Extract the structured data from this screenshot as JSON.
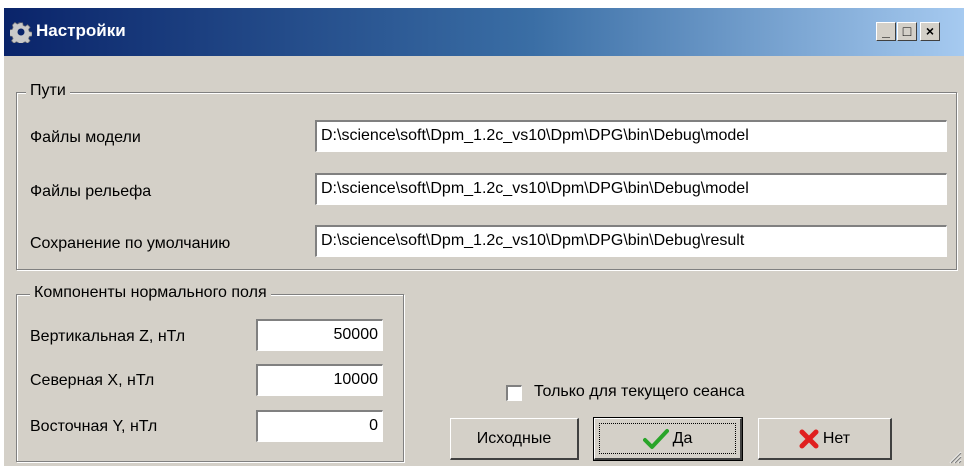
{
  "window": {
    "title": "Настройки",
    "controls": {
      "minimize": "_",
      "maximize": "□",
      "close": "×"
    }
  },
  "paths": {
    "group_label": "Пути",
    "model_files_label": "Файлы модели",
    "model_files_value": "D:\\science\\soft\\Dpm_1.2c_vs10\\Dpm\\DPG\\bin\\Debug\\model",
    "relief_files_label": "Файлы рельефа",
    "relief_files_value": "D:\\science\\soft\\Dpm_1.2c_vs10\\Dpm\\DPG\\bin\\Debug\\model",
    "default_save_label": "Сохранение по умолчанию",
    "default_save_value": "D:\\science\\soft\\Dpm_1.2c_vs10\\Dpm\\DPG\\bin\\Debug\\result"
  },
  "normal_field": {
    "group_label": "Компоненты нормального поля",
    "vertical_label": "Вертикальная Z, нТл",
    "vertical_value": "50000",
    "north_label": "Северная X, нТл",
    "north_value": "10000",
    "east_label": "Восточная Y, нТл",
    "east_value": "0"
  },
  "session_only": {
    "label": "Только для текущего сеанса",
    "checked": false
  },
  "buttons": {
    "defaults": "Исходные",
    "yes": "Да",
    "no": "Нет"
  },
  "icons": {
    "title": "gear-icon",
    "yes": "checkmark-icon",
    "no": "red-x-icon",
    "grip": "resize-grip-icon"
  },
  "colors": {
    "yes_icon": "#2aa52a",
    "no_icon": "#e02020"
  }
}
